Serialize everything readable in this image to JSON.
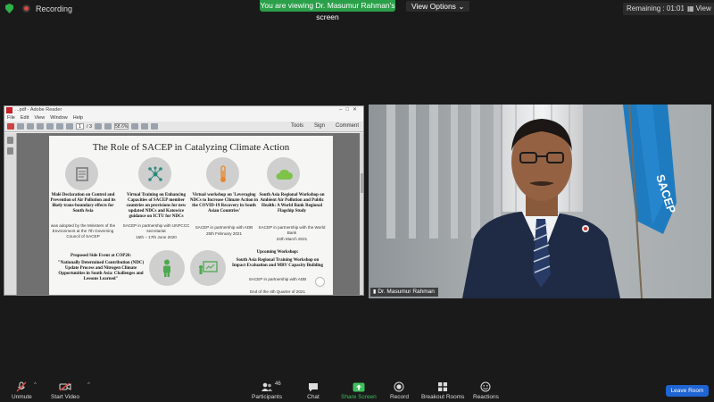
{
  "topbar": {
    "recording_label": "Recording",
    "viewing_banner": "You are viewing Dr. Masumur Rahman's screen",
    "view_options_label": "View Options",
    "remaining_label": "Remaining : 01:01:07",
    "view_button_label": "View"
  },
  "acrobat": {
    "window_title": "...pdf - Adobe Reader",
    "menu": [
      "File",
      "Edit",
      "View",
      "Window",
      "Help"
    ],
    "page_current": "1",
    "page_total": "/ 3",
    "zoom": "58.6%",
    "tools_label": "Tools",
    "sign_label": "Sign",
    "comment_label": "Comment"
  },
  "slide": {
    "title": "The Role of SACEP in Catalyzing Climate Action",
    "columns": [
      {
        "heading": "Malé Declaration on Control and Prevention of Air Pollution and its likely trans-boundary effects for South Asia",
        "detail": "was adopted by the Ministers of the Environment at the 7th Governing Council of SACEP"
      },
      {
        "heading": "Virtual Training on Enhancing Capacities of SACEP member countries on provisions for new updated NDCs and Katowice guidance on ICTU for NDCs",
        "detail": "SACEP in partnership with UNFCCC secretariat",
        "date": "15th – 17th June 2020"
      },
      {
        "heading": "Virtual workshop on 'Leveraging NDCs to Increase Climate Action in the COVID-19 Recovery in South Asian Countries'",
        "detail": "SACEP in partnership with ADB",
        "date": "25th February 2021"
      },
      {
        "heading": "South Asia Regional Workshop on Ambient Air Pollution and Public Health: A World Bank Regional Flagship Study",
        "detail": "SACEP in partnership with the World Bank",
        "date": "24th March 2021"
      }
    ],
    "side_event_label": "Proposed Side Event at COP26:",
    "side_event_text": "\"Nationally Determined Contribution (NDC) Update Process and Nitrogen Climate Opportunities in South Asia: Challenges and Lessons Learned\"",
    "upcoming_label": "Upcoming Workshop:",
    "upcoming_text": "South Asia Regional Training Workshop on Impact Evaluation and MRV Capacity Building",
    "upcoming_partner": "SACEP in partnership with ADB",
    "upcoming_date": "End of the 4th Quarter of 2021"
  },
  "video": {
    "participant_name": "Dr. Masumur Rahman",
    "flag_text": "SACEP"
  },
  "controls": {
    "unmute": "Unmute",
    "start_video": "Start Video",
    "participants": "Participants",
    "participants_count": "46",
    "chat": "Chat",
    "share_screen": "Share Screen",
    "record": "Record",
    "breakout_rooms": "Breakout Rooms",
    "reactions": "Reactions",
    "leave_room": "Leave Room"
  },
  "colors": {
    "share_green": "#2ba04a",
    "leave_blue": "#1f64d3",
    "mute_red": "#e0463e",
    "flag_blue": "#1f7bc0"
  }
}
